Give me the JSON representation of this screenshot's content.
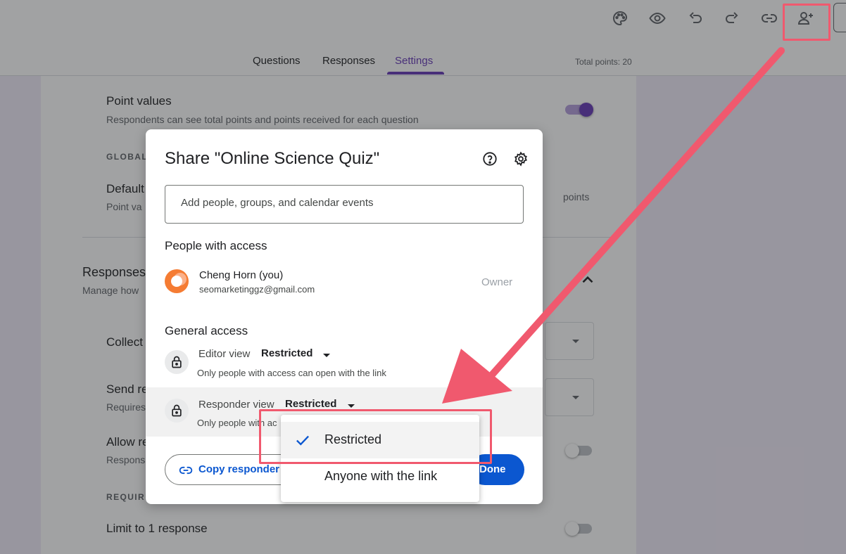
{
  "toolbar": {
    "icons": [
      "palette-icon",
      "eye-icon",
      "undo-icon",
      "redo-icon",
      "link-icon",
      "add-person-icon"
    ]
  },
  "tabs": [
    {
      "label": "Questions"
    },
    {
      "label": "Responses"
    },
    {
      "label": "Settings",
      "active": true
    }
  ],
  "total_points": "Total points: 20",
  "settings": {
    "point_values": {
      "title": "Point values",
      "desc": "Respondents can see total points and points received for each question",
      "enabled": true
    },
    "global_header": "GLOBAL",
    "default_title": "Default",
    "default_desc": "Point va",
    "default_unit": "points",
    "responses_title": "Responses",
    "responses_desc": "Manage how",
    "collect_title": "Collect",
    "send_title": "Send re",
    "send_desc": "Requires",
    "allow_title": "Allow re",
    "allow_desc": "Respons",
    "requires_header": "REQUIRE",
    "limit_title": "Limit to 1 response"
  },
  "dialog": {
    "title": "Share \"Online Science Quiz\"",
    "add_placeholder": "Add people, groups, and calendar events",
    "people_heading": "People with access",
    "person": {
      "name": "Cheng Horn (you)",
      "email": "seomarketinggz@gmail.com",
      "role": "Owner"
    },
    "general_heading": "General access",
    "editor": {
      "label": "Editor view",
      "value": "Restricted",
      "desc": "Only people with access can open with the link"
    },
    "responder": {
      "label": "Responder view",
      "value": "Restricted",
      "desc": "Only people with ac"
    },
    "copy_label": "Copy responder",
    "done_label": "Done"
  },
  "menu": {
    "options": [
      {
        "label": "Restricted",
        "selected": true
      },
      {
        "label": "Anyone with the link",
        "selected": false
      }
    ]
  },
  "colors": {
    "accent_purple": "#673ab7",
    "primary_blue": "#0b57d0",
    "annotation": "#f0596e"
  }
}
